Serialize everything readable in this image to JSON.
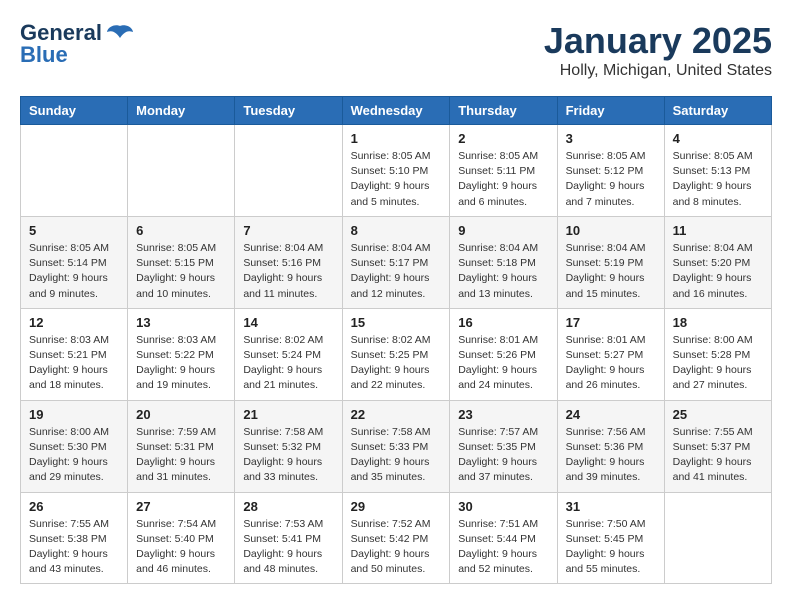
{
  "logo": {
    "line1": "General",
    "line2": "Blue"
  },
  "title": "January 2025",
  "subtitle": "Holly, Michigan, United States",
  "days_header": [
    "Sunday",
    "Monday",
    "Tuesday",
    "Wednesday",
    "Thursday",
    "Friday",
    "Saturday"
  ],
  "weeks": [
    [
      {
        "day": "",
        "info": ""
      },
      {
        "day": "",
        "info": ""
      },
      {
        "day": "",
        "info": ""
      },
      {
        "day": "1",
        "info": "Sunrise: 8:05 AM\nSunset: 5:10 PM\nDaylight: 9 hours\nand 5 minutes."
      },
      {
        "day": "2",
        "info": "Sunrise: 8:05 AM\nSunset: 5:11 PM\nDaylight: 9 hours\nand 6 minutes."
      },
      {
        "day": "3",
        "info": "Sunrise: 8:05 AM\nSunset: 5:12 PM\nDaylight: 9 hours\nand 7 minutes."
      },
      {
        "day": "4",
        "info": "Sunrise: 8:05 AM\nSunset: 5:13 PM\nDaylight: 9 hours\nand 8 minutes."
      }
    ],
    [
      {
        "day": "5",
        "info": "Sunrise: 8:05 AM\nSunset: 5:14 PM\nDaylight: 9 hours\nand 9 minutes."
      },
      {
        "day": "6",
        "info": "Sunrise: 8:05 AM\nSunset: 5:15 PM\nDaylight: 9 hours\nand 10 minutes."
      },
      {
        "day": "7",
        "info": "Sunrise: 8:04 AM\nSunset: 5:16 PM\nDaylight: 9 hours\nand 11 minutes."
      },
      {
        "day": "8",
        "info": "Sunrise: 8:04 AM\nSunset: 5:17 PM\nDaylight: 9 hours\nand 12 minutes."
      },
      {
        "day": "9",
        "info": "Sunrise: 8:04 AM\nSunset: 5:18 PM\nDaylight: 9 hours\nand 13 minutes."
      },
      {
        "day": "10",
        "info": "Sunrise: 8:04 AM\nSunset: 5:19 PM\nDaylight: 9 hours\nand 15 minutes."
      },
      {
        "day": "11",
        "info": "Sunrise: 8:04 AM\nSunset: 5:20 PM\nDaylight: 9 hours\nand 16 minutes."
      }
    ],
    [
      {
        "day": "12",
        "info": "Sunrise: 8:03 AM\nSunset: 5:21 PM\nDaylight: 9 hours\nand 18 minutes."
      },
      {
        "day": "13",
        "info": "Sunrise: 8:03 AM\nSunset: 5:22 PM\nDaylight: 9 hours\nand 19 minutes."
      },
      {
        "day": "14",
        "info": "Sunrise: 8:02 AM\nSunset: 5:24 PM\nDaylight: 9 hours\nand 21 minutes."
      },
      {
        "day": "15",
        "info": "Sunrise: 8:02 AM\nSunset: 5:25 PM\nDaylight: 9 hours\nand 22 minutes."
      },
      {
        "day": "16",
        "info": "Sunrise: 8:01 AM\nSunset: 5:26 PM\nDaylight: 9 hours\nand 24 minutes."
      },
      {
        "day": "17",
        "info": "Sunrise: 8:01 AM\nSunset: 5:27 PM\nDaylight: 9 hours\nand 26 minutes."
      },
      {
        "day": "18",
        "info": "Sunrise: 8:00 AM\nSunset: 5:28 PM\nDaylight: 9 hours\nand 27 minutes."
      }
    ],
    [
      {
        "day": "19",
        "info": "Sunrise: 8:00 AM\nSunset: 5:30 PM\nDaylight: 9 hours\nand 29 minutes."
      },
      {
        "day": "20",
        "info": "Sunrise: 7:59 AM\nSunset: 5:31 PM\nDaylight: 9 hours\nand 31 minutes."
      },
      {
        "day": "21",
        "info": "Sunrise: 7:58 AM\nSunset: 5:32 PM\nDaylight: 9 hours\nand 33 minutes."
      },
      {
        "day": "22",
        "info": "Sunrise: 7:58 AM\nSunset: 5:33 PM\nDaylight: 9 hours\nand 35 minutes."
      },
      {
        "day": "23",
        "info": "Sunrise: 7:57 AM\nSunset: 5:35 PM\nDaylight: 9 hours\nand 37 minutes."
      },
      {
        "day": "24",
        "info": "Sunrise: 7:56 AM\nSunset: 5:36 PM\nDaylight: 9 hours\nand 39 minutes."
      },
      {
        "day": "25",
        "info": "Sunrise: 7:55 AM\nSunset: 5:37 PM\nDaylight: 9 hours\nand 41 minutes."
      }
    ],
    [
      {
        "day": "26",
        "info": "Sunrise: 7:55 AM\nSunset: 5:38 PM\nDaylight: 9 hours\nand 43 minutes."
      },
      {
        "day": "27",
        "info": "Sunrise: 7:54 AM\nSunset: 5:40 PM\nDaylight: 9 hours\nand 46 minutes."
      },
      {
        "day": "28",
        "info": "Sunrise: 7:53 AM\nSunset: 5:41 PM\nDaylight: 9 hours\nand 48 minutes."
      },
      {
        "day": "29",
        "info": "Sunrise: 7:52 AM\nSunset: 5:42 PM\nDaylight: 9 hours\nand 50 minutes."
      },
      {
        "day": "30",
        "info": "Sunrise: 7:51 AM\nSunset: 5:44 PM\nDaylight: 9 hours\nand 52 minutes."
      },
      {
        "day": "31",
        "info": "Sunrise: 7:50 AM\nSunset: 5:45 PM\nDaylight: 9 hours\nand 55 minutes."
      },
      {
        "day": "",
        "info": ""
      }
    ]
  ]
}
